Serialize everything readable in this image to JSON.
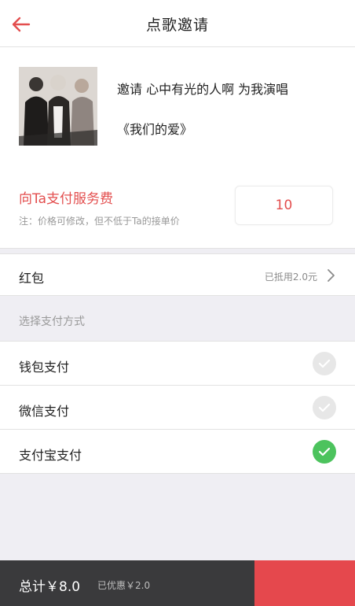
{
  "header": {
    "title": "点歌邀请"
  },
  "invite": {
    "text": "邀请 心中有光的人啊 为我演唱",
    "song": "《我们的爱》"
  },
  "fee": {
    "title": "向Ta支付服务费",
    "note": "注：价格可修改，但不低于Ta的接单价",
    "value": "10"
  },
  "hongbao": {
    "label": "红包",
    "value": "已抵用2.0元"
  },
  "payment": {
    "section_label": "选择支付方式",
    "methods": [
      {
        "label": "钱包支付",
        "selected": false
      },
      {
        "label": "微信支付",
        "selected": false
      },
      {
        "label": "支付宝支付",
        "selected": true
      }
    ]
  },
  "footer": {
    "total": "总计￥8.0",
    "saved": "已优惠￥2.0"
  },
  "colors": {
    "accent_red": "#e34e4e",
    "check_green": "#4cc35d",
    "bottom_bar": "#3a3a3c"
  }
}
